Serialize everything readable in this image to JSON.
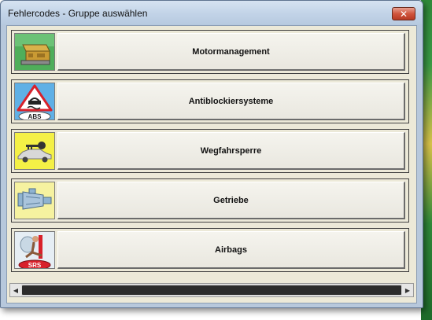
{
  "window": {
    "title": "Fehlercodes - Gruppe auswählen",
    "close_glyph": "✕"
  },
  "groups": [
    {
      "label": "Motormanagement",
      "icon": "engine-control-unit-icon",
      "icon_bg": "#4fae5a"
    },
    {
      "label": "Antiblockiersysteme",
      "icon": "abs-warning-icon",
      "icon_text": "ABS",
      "icon_bg": "#5fb0e6"
    },
    {
      "label": "Wegfahrsperre",
      "icon": "car-key-icon",
      "icon_bg": "#f4f046"
    },
    {
      "label": "Getriebe",
      "icon": "gearbox-icon",
      "icon_bg": "#f6f2a0"
    },
    {
      "label": "Airbags",
      "icon": "airbag-srs-icon",
      "icon_text": "SRS",
      "icon_bg": "#e6eef4"
    }
  ],
  "scrollbar": {
    "left_arrow": "◀",
    "right_arrow": "▶"
  }
}
